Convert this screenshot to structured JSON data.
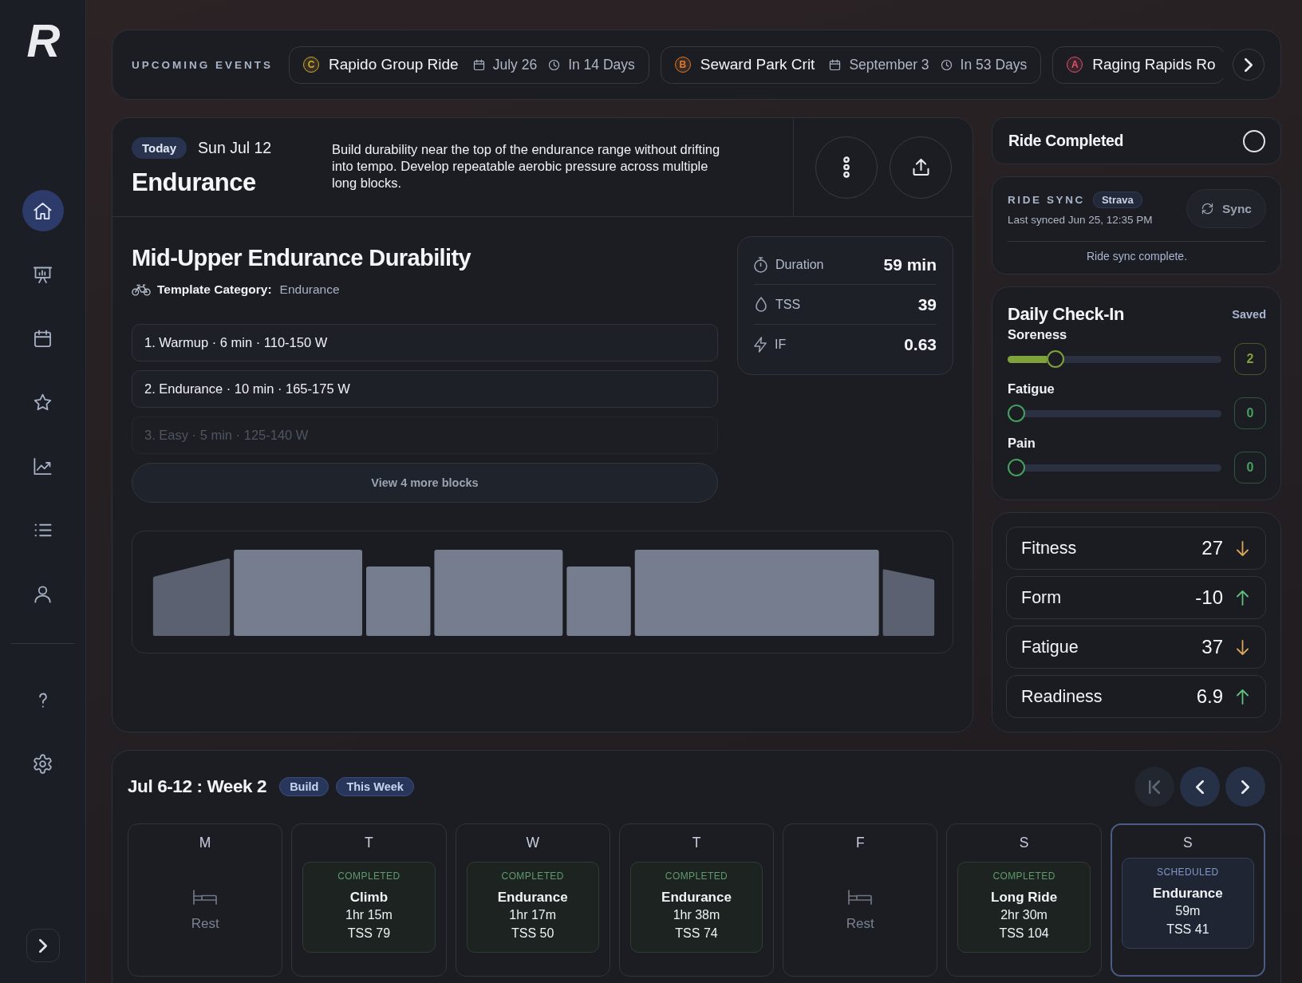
{
  "sidebar": {
    "logo": "R",
    "nav_items": [
      {
        "selected": true
      },
      {
        "selected": false
      },
      {
        "selected": false
      },
      {
        "selected": false
      },
      {
        "selected": false
      },
      {
        "selected": false
      },
      {
        "selected": false
      }
    ],
    "footer_items": [
      {
        "selected": false
      },
      {
        "selected": false
      }
    ]
  },
  "upcoming_events": {
    "title": "UPCOMING EVENTS",
    "events": [
      {
        "priority": "C",
        "color": "#d4a72c",
        "name": "Rapido Group Ride",
        "date": "July 26",
        "countdown": "In 14 Days"
      },
      {
        "priority": "B",
        "color": "#e0782c",
        "name": "Seward Park Crit",
        "date": "September 3",
        "countdown": "In 53 Days"
      },
      {
        "priority": "A",
        "color": "#e2506a",
        "name": "Raging Rapids Ro"
      }
    ]
  },
  "today_workout": {
    "badge": "Today",
    "date": "Sun Jul 12",
    "type": "Endurance",
    "description": "Build durability near the top of the endurance range without drifting into tempo. Develop repeatable aerobic pressure across multiple long blocks.",
    "title": "Mid-Upper Endurance Durability",
    "category_label": "Template Category:",
    "category": "Endurance",
    "blocks": [
      {
        "label": "1. Warmup · 6 min · 110-150 W",
        "faded": false
      },
      {
        "label": "2. Endurance · 10 min · 165-175 W",
        "faded": false
      },
      {
        "label": "3. Easy · 5 min · 125-140 W",
        "faded": true
      }
    ],
    "more_button": "View 4 more blocks",
    "stats": [
      {
        "label": "Duration",
        "value": "59 min"
      },
      {
        "label": "TSS",
        "value": "39"
      },
      {
        "label": "IF",
        "value": "0.63"
      }
    ]
  },
  "ride_completed": {
    "label": "Ride Completed",
    "checked": false
  },
  "ride_sync": {
    "title": "RIDE SYNC",
    "provider": "Strava",
    "last_synced": "Last synced Jun 25, 12:35 PM",
    "button": "Sync",
    "status": "Ride sync complete."
  },
  "check_in": {
    "title": "Daily Check-In",
    "status": "Saved",
    "items": [
      {
        "label": "Soreness",
        "level": 0.2,
        "value": "2",
        "color": "#7fa23a"
      },
      {
        "label": "Fatigue",
        "level": 0,
        "value": "0",
        "color": "#46a05e"
      },
      {
        "label": "Pain",
        "level": 0,
        "value": "0",
        "color": "#46a05e"
      }
    ]
  },
  "metrics": [
    {
      "label": "Fitness",
      "value": "27",
      "rising": false
    },
    {
      "label": "Form",
      "value": "-10",
      "rising": true
    },
    {
      "label": "Fatigue",
      "value": "37",
      "rising": false
    },
    {
      "label": "Readiness",
      "value": "6.9",
      "rising": true
    }
  ],
  "week": {
    "title": "Jul 6-12 : Week 2",
    "tags": [
      "Build",
      "This Week"
    ],
    "nav_buttons": [
      {
        "disabled": true
      },
      {
        "disabled": false
      },
      {
        "disabled": false
      }
    ],
    "days": [
      {
        "letter": "M",
        "kind": "rest",
        "label": "Rest",
        "selected": false
      },
      {
        "letter": "T",
        "kind": "workout",
        "completed": true,
        "status": "COMPLETED",
        "name": "Climb",
        "duration": "1hr 15m",
        "tss": "TSS 79",
        "selected": false
      },
      {
        "letter": "W",
        "kind": "workout",
        "completed": true,
        "status": "COMPLETED",
        "name": "Endurance",
        "duration": "1hr 17m",
        "tss": "TSS 50",
        "selected": false
      },
      {
        "letter": "T",
        "kind": "workout",
        "completed": true,
        "status": "COMPLETED",
        "name": "Endurance",
        "duration": "1hr 38m",
        "tss": "TSS 74",
        "selected": false
      },
      {
        "letter": "F",
        "kind": "rest",
        "label": "Rest",
        "selected": false
      },
      {
        "letter": "S",
        "kind": "workout",
        "completed": true,
        "status": "COMPLETED",
        "name": "Long Ride",
        "duration": "2hr 30m",
        "tss": "TSS 104",
        "selected": false
      },
      {
        "letter": "S",
        "kind": "workout",
        "completed": false,
        "status": "SCHEDULED",
        "name": "Endurance",
        "duration": "59m",
        "tss": "TSS 41",
        "selected": true
      }
    ]
  }
}
